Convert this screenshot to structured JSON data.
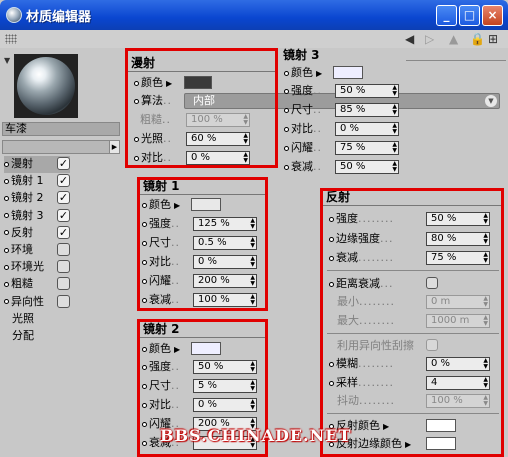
{
  "window": {
    "title": "材质编辑器",
    "minimize": "_",
    "maximize": "□",
    "close": "×"
  },
  "material": {
    "name": "车漆"
  },
  "channels": [
    {
      "label": "漫射",
      "checked": true,
      "active": true,
      "has_checkbox": true,
      "has_dot": true
    },
    {
      "label": "镜射 1",
      "checked": true,
      "has_checkbox": true,
      "has_dot": true
    },
    {
      "label": "镜射 2",
      "checked": true,
      "has_checkbox": true,
      "has_dot": true
    },
    {
      "label": "镜射 3",
      "checked": true,
      "has_checkbox": true,
      "has_dot": true
    },
    {
      "label": "反射",
      "checked": true,
      "has_checkbox": true,
      "has_dot": true
    },
    {
      "label": "环境",
      "checked": false,
      "has_checkbox": true,
      "has_dot": true
    },
    {
      "label": "环境光",
      "checked": false,
      "has_checkbox": true,
      "has_dot": true
    },
    {
      "label": "粗糙",
      "checked": false,
      "has_checkbox": true,
      "has_dot": true
    },
    {
      "label": "异向性",
      "checked": false,
      "has_checkbox": true,
      "has_dot": true
    },
    {
      "label": "光照",
      "has_checkbox": false,
      "has_dot": false
    },
    {
      "label": "分配",
      "has_checkbox": false,
      "has_dot": false
    }
  ],
  "diffuse": {
    "title": "漫射",
    "color_label": "颜色",
    "color_value": "#3a3a3a",
    "algorithm_label": "算法",
    "algorithm_value": "内部",
    "roughness_label": "粗糙",
    "roughness_value": "100 %",
    "light_label": "光照",
    "light_value": "60 %",
    "contrast_label": "对比",
    "contrast_value": "0 %"
  },
  "spec1": {
    "title": "镜射 1",
    "color_label": "颜色",
    "color_value": "#e8e8e8",
    "rows": [
      {
        "label": "强度",
        "value": "125 %"
      },
      {
        "label": "尺寸",
        "value": "0.5 %"
      },
      {
        "label": "对比",
        "value": "0 %"
      },
      {
        "label": "闪耀",
        "value": "200 %"
      },
      {
        "label": "衰减",
        "value": "100 %"
      }
    ]
  },
  "spec2": {
    "title": "镜射 2",
    "color_label": "颜色",
    "color_value": "#eeeeff",
    "rows": [
      {
        "label": "强度",
        "value": "50 %"
      },
      {
        "label": "尺寸",
        "value": "5 %"
      },
      {
        "label": "对比",
        "value": "0 %"
      },
      {
        "label": "闪耀",
        "value": "200 %"
      },
      {
        "label": "衰减",
        "value": ""
      }
    ]
  },
  "spec3": {
    "title": "镜射 3",
    "color_label": "颜色",
    "color_value": "#eeeeff",
    "rows": [
      {
        "label": "强度",
        "value": "50 %"
      },
      {
        "label": "尺寸",
        "value": "85 %"
      },
      {
        "label": "对比",
        "value": "0 %"
      },
      {
        "label": "闪耀",
        "value": "75 %"
      },
      {
        "label": "衰减",
        "value": "50 %"
      }
    ]
  },
  "reflection": {
    "title": "反射",
    "strength_label": "强度",
    "strength_value": "50 %",
    "edge_label": "边缘强度",
    "edge_value": "80 %",
    "falloff_label": "衰减",
    "falloff_value": "75 %",
    "distance_label": "距离衰减",
    "min_label": "最小",
    "min_value": "0 m",
    "max_label": "最大",
    "max_value": "1000 m",
    "aniso_label": "利用异向性刮擦",
    "blur_label": "模糊",
    "blur_value": "0 %",
    "sample_label": "采样",
    "sample_value": "4",
    "jitter_label": "抖动",
    "jitter_value": "100 %",
    "refl_color_label": "反射颜色",
    "refl_color_value": "#ffffff",
    "edge_color_label": "反射边缘颜色",
    "edge_color_value": "#ffffff"
  },
  "watermark": "BBS.CHINADE.NET",
  "colors": {
    "highlight": "#e00000",
    "title_bar": "#0a46d0"
  }
}
